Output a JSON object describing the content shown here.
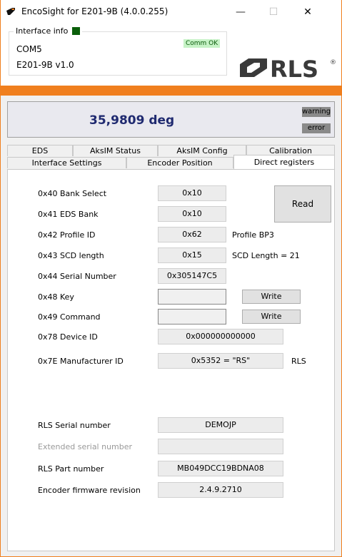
{
  "window": {
    "title": "EncoSight for E201-9B (4.0.0.255)",
    "minimize_glyph": "—",
    "maximize_glyph": "☐",
    "close_glyph": "✕"
  },
  "interface": {
    "legend": "Interface info",
    "port": "COM5",
    "device": "E201-9B v1.0",
    "comm_status": "Comm OK"
  },
  "logo": {
    "text": "RLS",
    "registered": "®"
  },
  "position": {
    "value": "35,9809 deg",
    "warning_label": "warning",
    "error_label": "error"
  },
  "tabs": {
    "row1": [
      "EDS",
      "AksIM Status",
      "AksIM Config",
      "Calibration"
    ],
    "row2": [
      "Interface Settings",
      "Encoder Position",
      "Direct registers"
    ],
    "active": "Direct registers"
  },
  "registers": {
    "bank_select": {
      "label": "0x40 Bank Select",
      "value": "0x10"
    },
    "eds_bank": {
      "label": "0x41 EDS Bank",
      "value": "0x10"
    },
    "profile_id": {
      "label": "0x42 Profile ID",
      "value": "0x62",
      "note": "Profile BP3"
    },
    "scd_length": {
      "label": "0x43 SCD length",
      "value": "0x15",
      "note": "SCD Length = 21"
    },
    "serial_number": {
      "label": "0x44 Serial Number",
      "value": "0x305147C5"
    },
    "key": {
      "label": "0x48 Key",
      "value": "",
      "button": "Write"
    },
    "command": {
      "label": "0x49 Command",
      "value": "",
      "button": "Write"
    },
    "device_id": {
      "label": "0x78 Device ID",
      "value": "0x000000000000"
    },
    "manufacturer_id": {
      "label": "0x7E Manufacturer ID",
      "value": "0x5352 = \"RS\"",
      "note": "RLS"
    },
    "read_button": "Read"
  },
  "info": {
    "rls_serial": {
      "label": "RLS Serial number",
      "value": "DEMOJP"
    },
    "extended_serial": {
      "label": "Extended serial number",
      "value": ""
    },
    "part_number": {
      "label": "RLS Part number",
      "value": "MB049DCC19BDNA08"
    },
    "firmware": {
      "label": "Encoder firmware revision",
      "value": "2.4.9.2710"
    }
  },
  "colors": {
    "accent_orange": "#f07f1e",
    "position_text": "#1f2a70",
    "led_green": "#0a5e0a",
    "comm_ok_bg": "#c6f2c6"
  }
}
